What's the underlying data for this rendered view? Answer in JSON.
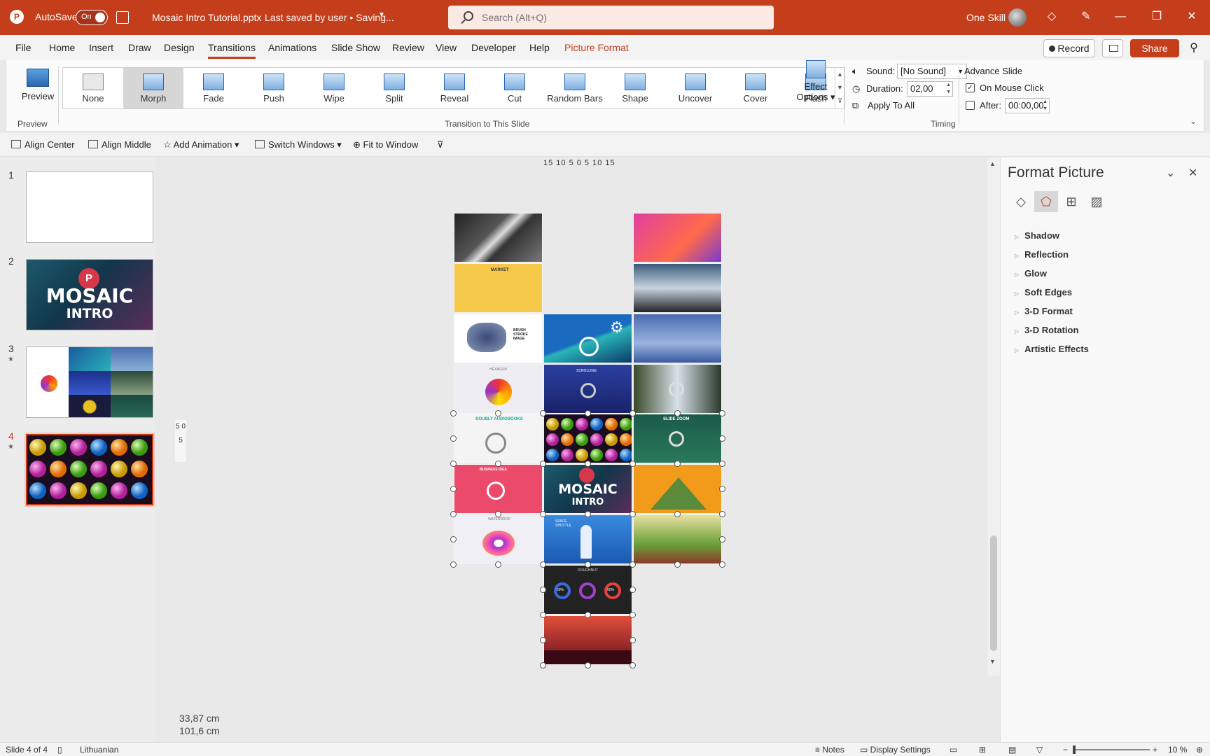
{
  "titlebar": {
    "autosave_label": "AutoSave",
    "autosave_state": "On",
    "document_title": "Mosaic Intro Tutorial.pptx",
    "save_status": "Last saved by user • Saving...",
    "search_placeholder": "Search (Alt+Q)",
    "user_name": "One Skill"
  },
  "menu": {
    "items": [
      "File",
      "Home",
      "Insert",
      "Draw",
      "Design",
      "Transitions",
      "Animations",
      "Slide Show",
      "Review",
      "View",
      "Developer",
      "Help",
      "Picture Format"
    ],
    "active": "Transitions",
    "record_label": "Record",
    "share_label": "Share"
  },
  "ribbon": {
    "preview_label": "Preview",
    "preview_group": "Preview",
    "transitions_group": "Transition to This Slide",
    "timing_group": "Timing",
    "transitions": [
      "None",
      "Morph",
      "Fade",
      "Push",
      "Wipe",
      "Split",
      "Reveal",
      "Cut",
      "Random Bars",
      "Shape",
      "Uncover",
      "Cover",
      "Flash"
    ],
    "selected_transition": "Morph",
    "effect_options_line1": "Effect",
    "effect_options_line2": "Options",
    "sound_label": "Sound:",
    "sound_value": "[No Sound]",
    "duration_label": "Duration:",
    "duration_value": "02,00",
    "apply_all_label": "Apply To All",
    "advance_label": "Advance Slide",
    "on_mouse_click_label": "On Mouse Click",
    "on_mouse_click_checked": true,
    "after_label": "After:",
    "after_value": "00:00,00"
  },
  "qat": {
    "items": [
      "Align Center",
      "Align Middle",
      "Add Animation",
      "Switch Windows",
      "Fit to Window"
    ]
  },
  "slides": {
    "numbers": [
      "1",
      "2",
      "3",
      "4"
    ],
    "selected": 4,
    "slide2_text_1": "MOSAIC",
    "slide2_text_2": "INTRO"
  },
  "canvas": {
    "ruler_h": "15 10 5  0  5 10 15",
    "ruler_v": "5 0 5",
    "width_readout": "33,87 cm",
    "height_readout": "101,6 cm",
    "tile_labels": {
      "market": "MARKET",
      "brush": "BRUSH STROKE IMAGE",
      "hexagon": "HEXAGON",
      "scrolling": "SCROLLING",
      "doubly": "DOUBLY AUDIOBOOKS",
      "slidezoom": "SLIDE ZOOM",
      "business": "BUSINESS IDEA",
      "mosaic1": "MOSAIC",
      "mosaic2": "INTRO",
      "waterdrop": "WATERDROP",
      "shuttle": "SPACE SHUTTLE",
      "doughnut": "DOUGHNUT",
      "pct1": "60%",
      "pct2": "90%"
    }
  },
  "format_pane": {
    "title": "Format Picture",
    "sections": [
      "Shadow",
      "Reflection",
      "Glow",
      "Soft Edges",
      "3-D Format",
      "3-D Rotation",
      "Artistic Effects"
    ]
  },
  "status": {
    "slide_info": "Slide 4 of 4",
    "language": "Lithuanian",
    "notes_label": "Notes",
    "display_settings_label": "Display Settings",
    "zoom": "10 %"
  },
  "colors": {
    "brand": "#c43e1c",
    "ribbon_bg": "#fbfbfb",
    "canvas_bg": "#e9e9e9"
  }
}
